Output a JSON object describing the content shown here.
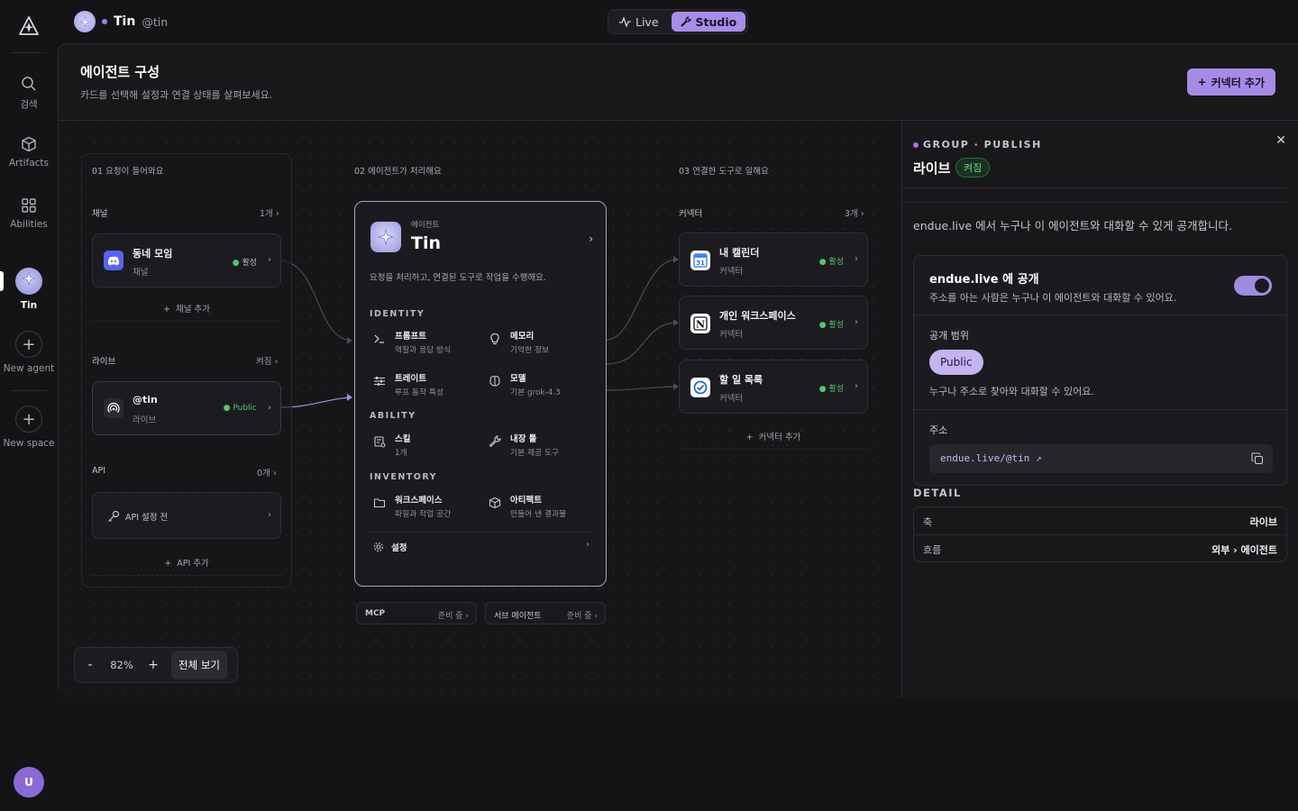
{
  "rail": {
    "items": [
      {
        "label": "검색",
        "icon": "search-icon"
      },
      {
        "label": "Artifacts",
        "icon": "cube-icon"
      },
      {
        "label": "Abilities",
        "icon": "grid-icon"
      },
      {
        "label": "Tin",
        "icon": "agent-avatar"
      },
      {
        "label": "New agent",
        "icon": "plus-icon"
      },
      {
        "label": "New space",
        "icon": "plus-icon"
      }
    ],
    "user_initial": "U"
  },
  "topbar": {
    "agent_name": "Tin",
    "agent_handle": "@tin",
    "modes": [
      {
        "label": "Live",
        "active": false
      },
      {
        "label": "Studio",
        "active": true
      }
    ]
  },
  "header": {
    "title": "에이전트 구성",
    "subtitle": "카드를 선택해 설정과 연결 상태를 살펴보세요.",
    "add_connector_label": "커넥터 추가"
  },
  "canvas": {
    "col1_title": "01   요청이 들어와요",
    "col2_title": "02   에이전트가 처리해요",
    "col3_title": "03   연결한 도구로 일해요",
    "channels": {
      "label": "채널",
      "count": "1개",
      "items": [
        {
          "title": "동네 모임",
          "sub": "채널",
          "status": "활성"
        }
      ],
      "add_label": "채널 추가"
    },
    "live": {
      "label": "라이브",
      "state": "켜짐",
      "items": [
        {
          "title": "@tin",
          "sub": "라이브",
          "status": "Public"
        }
      ]
    },
    "api": {
      "label": "API",
      "count": "0개",
      "item": "API 설정 전",
      "add_label": "API 추가"
    },
    "agent": {
      "kind": "에이전트",
      "name": "Tin",
      "description": "요청을 처리하고, 연결된 도구로 작업을 수행해요.",
      "identity_label": "IDENTITY",
      "identity": [
        {
          "title": "프롬프트",
          "sub": "역할과 응답 방식",
          "icon": "terminal-icon"
        },
        {
          "title": "메모리",
          "sub": "기억한 정보",
          "icon": "lightbulb-icon"
        },
        {
          "title": "트레이트",
          "sub": "루프 동작 특성",
          "icon": "sliders-icon"
        },
        {
          "title": "모델",
          "sub": "기본 grok-4.3",
          "icon": "brain-icon"
        }
      ],
      "ability_label": "ABILITY",
      "ability": [
        {
          "title": "스킬",
          "sub": "1개",
          "icon": "skill-icon"
        },
        {
          "title": "내장 툴",
          "sub": "기본 제공 도구",
          "icon": "wrench-icon"
        }
      ],
      "inventory_label": "INVENTORY",
      "inventory": [
        {
          "title": "워크스페이스",
          "sub": "파일과 작업 공간",
          "icon": "folder-icon"
        },
        {
          "title": "아티팩트",
          "sub": "만들어 낸 결과물",
          "icon": "cube-icon"
        }
      ],
      "settings_label": "설정"
    },
    "extras": [
      {
        "label": "MCP",
        "status": "준비 중"
      },
      {
        "label": "서브 에이전트",
        "status": "준비 중"
      }
    ],
    "connectors": {
      "label": "커넥터",
      "count": "3개",
      "items": [
        {
          "title": "내 캘린더",
          "sub": "커넥터",
          "status": "활성",
          "icon": "calendar-icon"
        },
        {
          "title": "개인 워크스페이스",
          "sub": "커넥터",
          "status": "활성",
          "icon": "notion-icon"
        },
        {
          "title": "할 일 목록",
          "sub": "커넥터",
          "status": "활성",
          "icon": "todo-icon"
        }
      ],
      "add_label": "커넥터 추가"
    },
    "zoom": {
      "minus": "-",
      "value": "82%",
      "plus": "+",
      "fit_label": "전체 보기"
    }
  },
  "panel": {
    "kicker": "GROUP · PUBLISH",
    "title": "라이브",
    "badge": "켜짐",
    "description": "endue.live 에서 누구나 이 에이전트와 대화할 수 있게 공개합니다.",
    "publish": {
      "title": "endue.live 에 공개",
      "subtitle": "주소를 아는 사람은 누구나 이 에이전트와 대화할 수 있어요.",
      "toggle_on": true,
      "scope_label": "공개 범위",
      "scope_value": "Public",
      "scope_note": "누구나 주소로 찾아와 대화할 수 있어요.",
      "address_label": "주소",
      "address_value": "endue.live/@tin ↗"
    },
    "detail_label": "DETAIL",
    "detail": [
      {
        "key": "축",
        "value": "라이브"
      },
      {
        "key": "흐름",
        "value": "외부 › 에이전트"
      }
    ]
  },
  "colors": {
    "accent": "#a58be6",
    "active_green": "#59c26b",
    "bg": "#141416"
  }
}
